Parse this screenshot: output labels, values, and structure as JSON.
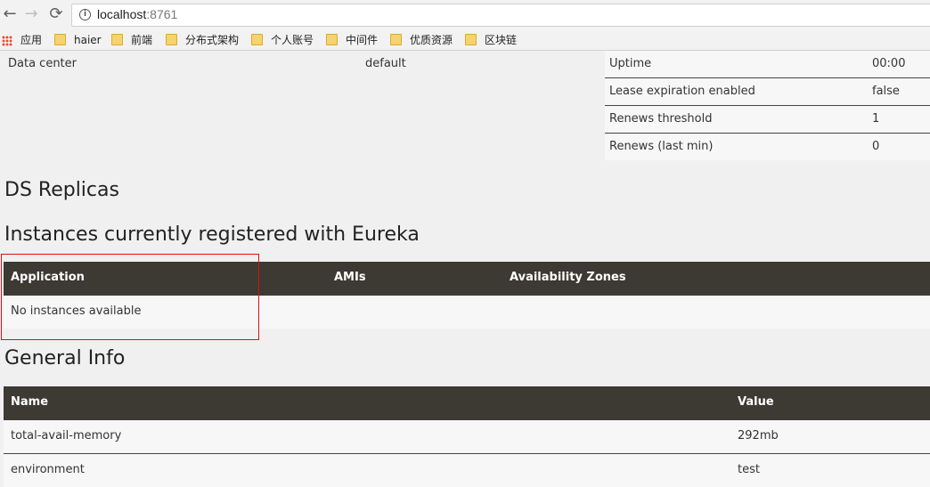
{
  "browser": {
    "back_icon": "←",
    "forward_icon": "→",
    "reload_icon": "⟳",
    "info_icon": "i",
    "url_host": "localhost",
    "url_port": ":8761"
  },
  "bookmarks": {
    "apps_label": "应用",
    "items": [
      "haier",
      "前端",
      "分布式架构",
      "个人账号",
      "中间件",
      "优质资源",
      "区块链"
    ]
  },
  "system_status": {
    "data_center_label": "Data center",
    "data_center_value": "default",
    "stats": [
      {
        "label": "Uptime",
        "value": "00:00"
      },
      {
        "label": "Lease expiration enabled",
        "value": "false"
      },
      {
        "label": "Renews threshold",
        "value": "1"
      },
      {
        "label": "Renews (last min)",
        "value": "0"
      }
    ]
  },
  "ds_replicas": {
    "title": "DS Replicas"
  },
  "instances": {
    "title": "Instances currently registered with Eureka",
    "columns": [
      "Application",
      "AMIs",
      "Availability Zones"
    ],
    "empty_message": "No instances available"
  },
  "general_info": {
    "title": "General Info",
    "columns": [
      "Name",
      "Value"
    ],
    "rows": [
      {
        "name": "total-avail-memory",
        "value": "292mb"
      },
      {
        "name": "environment",
        "value": "test"
      }
    ]
  },
  "colors": {
    "table_header": "#3d3933",
    "highlight_box": "#e01010"
  }
}
